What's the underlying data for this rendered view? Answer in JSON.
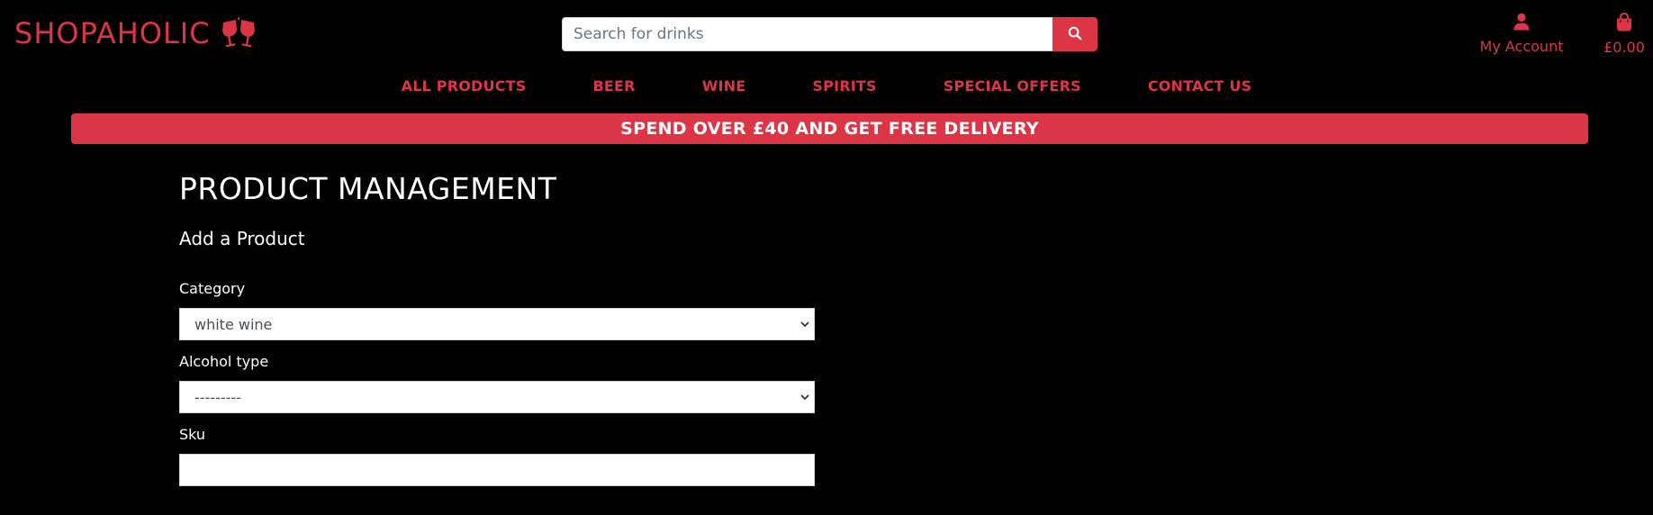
{
  "header": {
    "logo_text": "SHOPAHOLIC",
    "logo_icon": "glasses-cheers-icon",
    "search": {
      "placeholder": "Search for drinks",
      "value": "",
      "button_icon": "search-icon"
    },
    "account": {
      "label": "My Account",
      "icon": "user-icon"
    },
    "bag": {
      "label": "£0.00",
      "icon": "shopping-bag-icon"
    }
  },
  "nav": {
    "items": [
      {
        "label": "ALL PRODUCTS"
      },
      {
        "label": "BEER"
      },
      {
        "label": "WINE"
      },
      {
        "label": "SPIRITS"
      },
      {
        "label": "SPECIAL OFFERS"
      },
      {
        "label": "CONTACT US"
      }
    ]
  },
  "banner": {
    "text": "SPEND OVER £40 AND GET FREE DELIVERY"
  },
  "main": {
    "title": "PRODUCT MANAGEMENT",
    "subtitle": "Add a Product",
    "form": {
      "category": {
        "label": "Category",
        "value": "white wine"
      },
      "alcohol_type": {
        "label": "Alcohol type",
        "value": "---------"
      },
      "sku": {
        "label": "Sku",
        "value": ""
      }
    }
  },
  "colors": {
    "accent": "#dc3545",
    "background": "#000000",
    "text": "#ffffff"
  }
}
